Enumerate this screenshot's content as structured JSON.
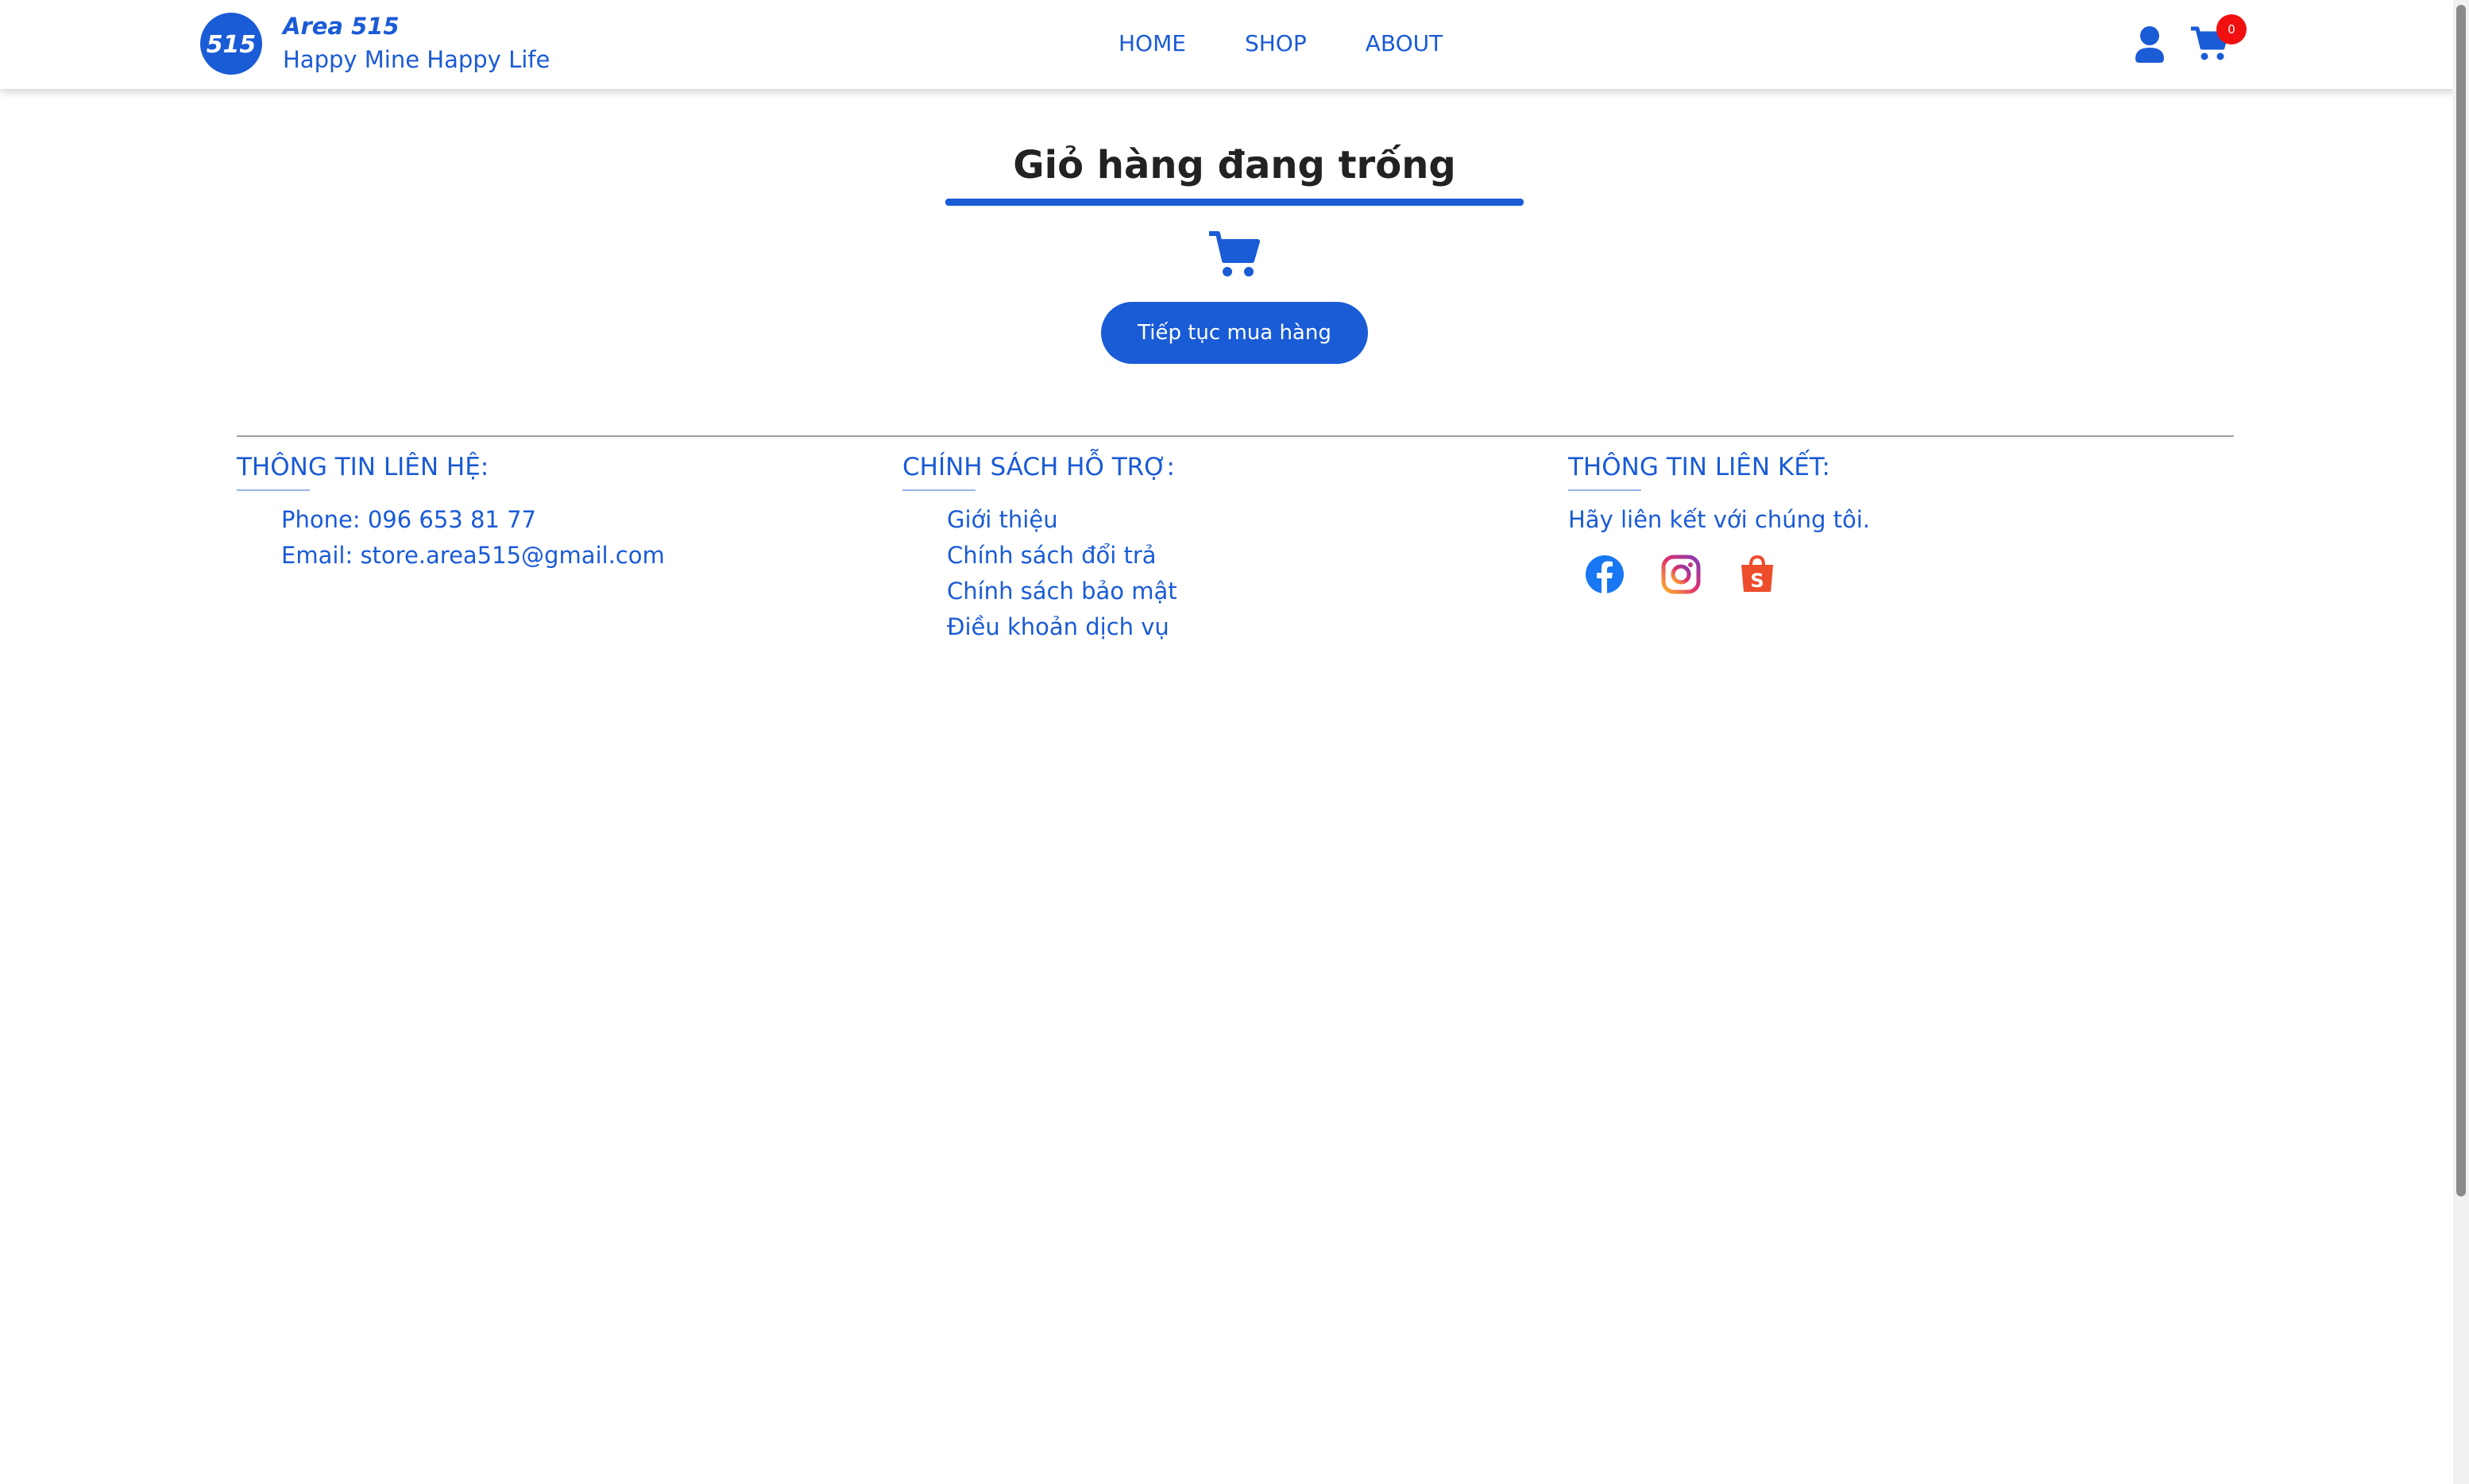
{
  "brand": {
    "name": "Area 515",
    "tagline": "Happy Mine Happy Life",
    "logo_text": "515"
  },
  "nav": {
    "home": "HOME",
    "shop": "SHOP",
    "about": "ABOUT"
  },
  "cart": {
    "count": "0"
  },
  "empty_cart": {
    "title": "Giỏ hàng đang trống",
    "continue_label": "Tiếp tục mua hàng"
  },
  "footer": {
    "contact": {
      "title": "THÔNG TIN LIÊN HỆ:",
      "phone": "Phone: 096 653 81 77",
      "email": "Email: store.area515@gmail.com"
    },
    "policy": {
      "title": "CHÍNH SÁCH HỖ TRỢ:",
      "items": [
        "Giới thiệu",
        "Chính sách đổi trả",
        "Chính sách bảo mật",
        "Điều khoản dịch vụ"
      ]
    },
    "links": {
      "title": "THÔNG TIN LIÊN KẾT:",
      "text": "Hãy liên kết với chúng tôi."
    }
  },
  "colors": {
    "accent": "#1a5bd6",
    "badge": "#f01010",
    "shopee": "#ee4d2d"
  },
  "icons": [
    "logo-icon",
    "user-icon",
    "cart-icon",
    "facebook-icon",
    "instagram-icon",
    "shopee-icon"
  ]
}
